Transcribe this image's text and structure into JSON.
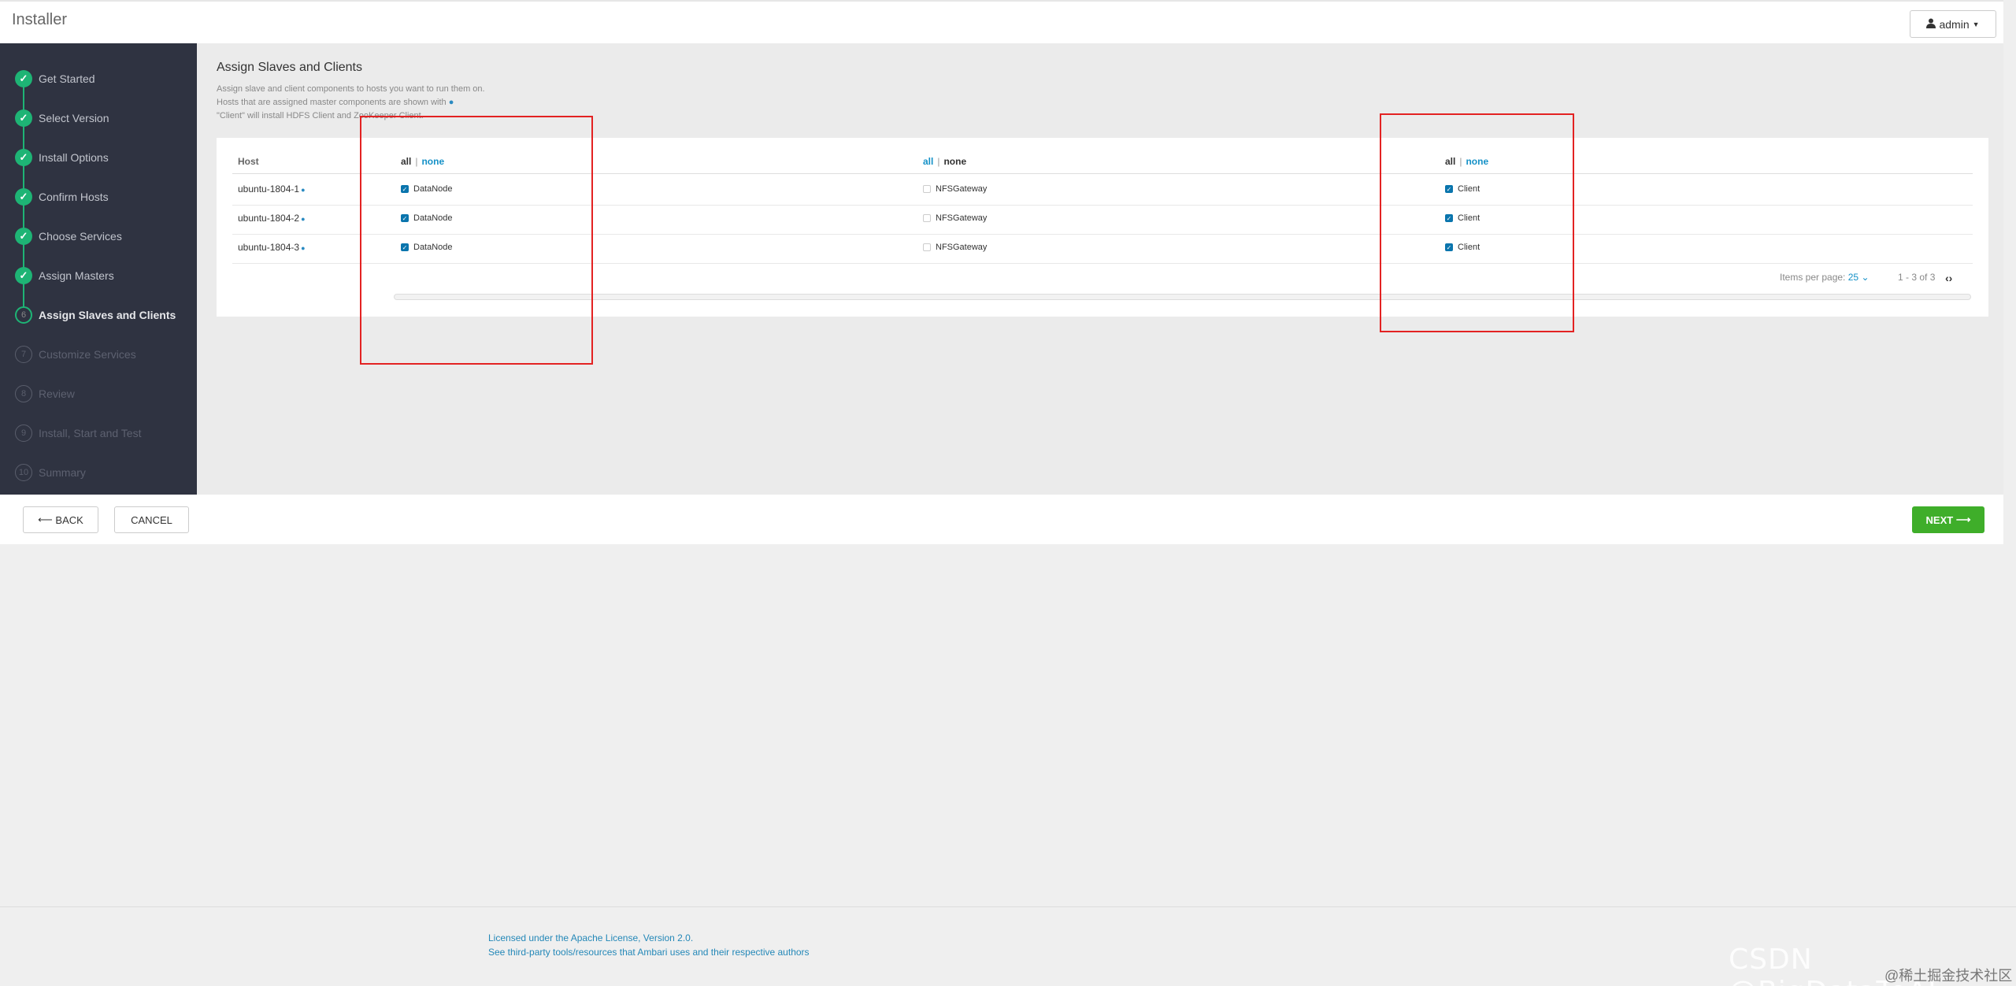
{
  "header": {
    "app_title": "Installer",
    "user_label": "admin"
  },
  "steps": [
    {
      "num": "1",
      "label": "Get Started",
      "state": "done"
    },
    {
      "num": "2",
      "label": "Select Version",
      "state": "done"
    },
    {
      "num": "3",
      "label": "Install Options",
      "state": "done"
    },
    {
      "num": "4",
      "label": "Confirm Hosts",
      "state": "done"
    },
    {
      "num": "5",
      "label": "Choose Services",
      "state": "done"
    },
    {
      "num": "6",
      "label": "Assign Masters",
      "state": "done"
    },
    {
      "num": "6",
      "label": "Assign Slaves and Clients",
      "state": "active"
    },
    {
      "num": "7",
      "label": "Customize Services",
      "state": "pending"
    },
    {
      "num": "8",
      "label": "Review",
      "state": "pending"
    },
    {
      "num": "9",
      "label": "Install, Start and Test",
      "state": "pending"
    },
    {
      "num": "10",
      "label": "Summary",
      "state": "pending"
    }
  ],
  "main": {
    "title": "Assign Slaves and Clients",
    "desc_line1": "Assign slave and client components to hosts you want to run them on.",
    "desc_line2": "Hosts that are assigned master components are shown with",
    "desc_line3": "\"Client\" will install HDFS Client and ZooKeeper Client."
  },
  "table": {
    "host_header": "Host",
    "toggle_all": "all",
    "toggle_sep": "|",
    "toggle_none": "none",
    "columns": [
      "DataNode",
      "NFSGateway",
      "Client"
    ],
    "rows": [
      {
        "host": "ubuntu-1804-1",
        "datanode": true,
        "nfs": false,
        "client": true
      },
      {
        "host": "ubuntu-1804-2",
        "datanode": true,
        "nfs": false,
        "client": true
      },
      {
        "host": "ubuntu-1804-3",
        "datanode": true,
        "nfs": false,
        "client": true
      }
    ],
    "items_per_page_label": "Items per page:",
    "items_per_page_value": "25",
    "range_text": "1 - 3 of 3"
  },
  "actions": {
    "back_label": "BACK",
    "cancel_label": "CANCEL",
    "next_label": "NEXT"
  },
  "footer": {
    "license": "Licensed under the Apache License, Version 2.0.",
    "third_party": "See third-party tools/resources that Ambari uses and their respective authors"
  },
  "watermark": {
    "main": "CSDN @BigDataToAI",
    "sub": "@稀土掘金技术社区"
  },
  "colors": {
    "sidebar_bg": "#2f3341",
    "step_done": "#1eb475",
    "link": "#1591c7",
    "next_bg": "#3fae2a",
    "highlight": "#e32222"
  }
}
